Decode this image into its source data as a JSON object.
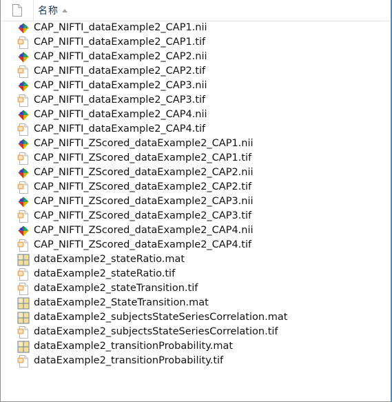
{
  "header": {
    "name_label": "名称"
  },
  "files": [
    {
      "name": "CAP_NIFTI_dataExample2_CAP1.nii",
      "icon": "nii-file-icon"
    },
    {
      "name": "CAP_NIFTI_dataExample2_CAP1.tif",
      "icon": "tif-file-icon"
    },
    {
      "name": "CAP_NIFTI_dataExample2_CAP2.nii",
      "icon": "nii-file-icon"
    },
    {
      "name": "CAP_NIFTI_dataExample2_CAP2.tif",
      "icon": "tif-file-icon"
    },
    {
      "name": "CAP_NIFTI_dataExample2_CAP3.nii",
      "icon": "nii-file-icon"
    },
    {
      "name": "CAP_NIFTI_dataExample2_CAP3.tif",
      "icon": "tif-file-icon"
    },
    {
      "name": "CAP_NIFTI_dataExample2_CAP4.nii",
      "icon": "nii-file-icon"
    },
    {
      "name": "CAP_NIFTI_dataExample2_CAP4.tif",
      "icon": "tif-file-icon"
    },
    {
      "name": "CAP_NIFTI_ZScored_dataExample2_CAP1.nii",
      "icon": "nii-file-icon"
    },
    {
      "name": "CAP_NIFTI_ZScored_dataExample2_CAP1.tif",
      "icon": "tif-file-icon"
    },
    {
      "name": "CAP_NIFTI_ZScored_dataExample2_CAP2.nii",
      "icon": "nii-file-icon"
    },
    {
      "name": "CAP_NIFTI_ZScored_dataExample2_CAP2.tif",
      "icon": "tif-file-icon"
    },
    {
      "name": "CAP_NIFTI_ZScored_dataExample2_CAP3.nii",
      "icon": "nii-file-icon"
    },
    {
      "name": "CAP_NIFTI_ZScored_dataExample2_CAP3.tif",
      "icon": "tif-file-icon"
    },
    {
      "name": "CAP_NIFTI_ZScored_dataExample2_CAP4.nii",
      "icon": "nii-file-icon"
    },
    {
      "name": "CAP_NIFTI_ZScored_dataExample2_CAP4.tif",
      "icon": "tif-file-icon"
    },
    {
      "name": "dataExample2_stateRatio.mat",
      "icon": "mat-file-icon"
    },
    {
      "name": "dataExample2_stateRatio.tif",
      "icon": "tif-file-icon"
    },
    {
      "name": "dataExample2_stateTransition.tif",
      "icon": "tif-file-icon"
    },
    {
      "name": "dataExample2_StateTransition.mat",
      "icon": "mat-file-icon"
    },
    {
      "name": "dataExample2_subjectsStateSeriesCorrelation.mat",
      "icon": "mat-file-icon"
    },
    {
      "name": "dataExample2_subjectsStateSeriesCorrelation.tif",
      "icon": "tif-file-icon"
    },
    {
      "name": "dataExample2_transitionProbability.mat",
      "icon": "mat-file-icon"
    },
    {
      "name": "dataExample2_transitionProbability.tif",
      "icon": "tif-file-icon"
    }
  ],
  "colors": {
    "header_text": "#1e395b",
    "selection_border": "#3c8fd9"
  }
}
